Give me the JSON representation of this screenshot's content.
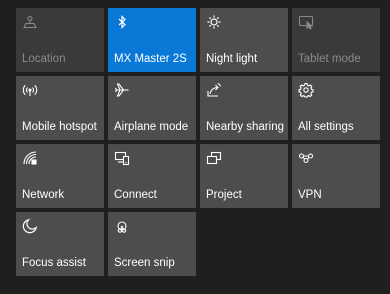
{
  "action_center": {
    "tiles": [
      {
        "label": "Location",
        "icon": "location-icon",
        "state": "disabled"
      },
      {
        "label": "MX Master 2S",
        "icon": "bluetooth-icon",
        "state": "active"
      },
      {
        "label": "Night light",
        "icon": "night-light-icon",
        "state": "off"
      },
      {
        "label": "Tablet mode",
        "icon": "tablet-mode-icon",
        "state": "disabled"
      },
      {
        "label": "Mobile hotspot",
        "icon": "mobile-hotspot-icon",
        "state": "off"
      },
      {
        "label": "Airplane mode",
        "icon": "airplane-icon",
        "state": "off"
      },
      {
        "label": "Nearby sharing",
        "icon": "nearby-sharing-icon",
        "state": "off"
      },
      {
        "label": "All settings",
        "icon": "gear-icon",
        "state": "off"
      },
      {
        "label": "Network",
        "icon": "network-icon",
        "state": "off"
      },
      {
        "label": "Connect",
        "icon": "connect-icon",
        "state": "off"
      },
      {
        "label": "Project",
        "icon": "project-icon",
        "state": "off"
      },
      {
        "label": "VPN",
        "icon": "vpn-icon",
        "state": "off"
      },
      {
        "label": "Focus assist",
        "icon": "moon-icon",
        "state": "off"
      },
      {
        "label": "Screen snip",
        "icon": "screen-snip-icon",
        "state": "off"
      }
    ],
    "colors": {
      "background": "#1f1f1f",
      "tile": "#4d4d4d",
      "tile_active": "#0a78d6",
      "tile_disabled": "#3a3a3a",
      "text": "#ffffff",
      "text_disabled": "#8a8a8a"
    }
  }
}
